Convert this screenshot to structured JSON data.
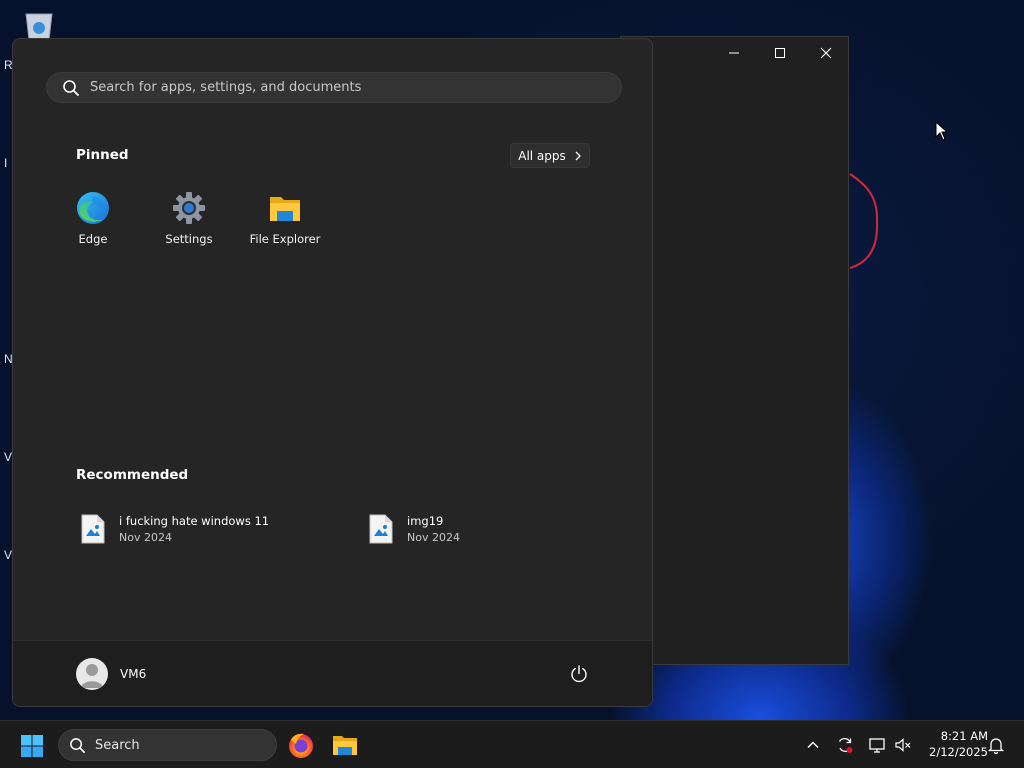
{
  "desktop": {
    "letters": [
      "R",
      "I",
      "N",
      "V",
      "V"
    ]
  },
  "start_menu": {
    "search": {
      "placeholder": "Search for apps, settings, and documents"
    },
    "pinned": {
      "title": "Pinned",
      "all_apps_label": "All apps",
      "apps": [
        {
          "label": "Edge",
          "icon": "edge-icon"
        },
        {
          "label": "Settings",
          "icon": "gear-icon"
        },
        {
          "label": "File Explorer",
          "icon": "folder-icon"
        }
      ]
    },
    "recommended": {
      "title": "Recommended",
      "items": [
        {
          "name": "i fucking hate windows 11",
          "date": "Nov 2024",
          "icon": "image-file-icon"
        },
        {
          "name": "img19",
          "date": "Nov 2024",
          "icon": "image-file-icon"
        }
      ]
    },
    "user": {
      "name": "VM6"
    }
  },
  "taskbar": {
    "search_label": "Search",
    "time": "8:21 AM",
    "date": "2/12/2025"
  },
  "colors": {
    "menu_bg": "#252525",
    "footer_bg": "#1e1e1e",
    "taskbar_bg": "#1c1c1c",
    "accent_blue": "#3a9bff"
  }
}
